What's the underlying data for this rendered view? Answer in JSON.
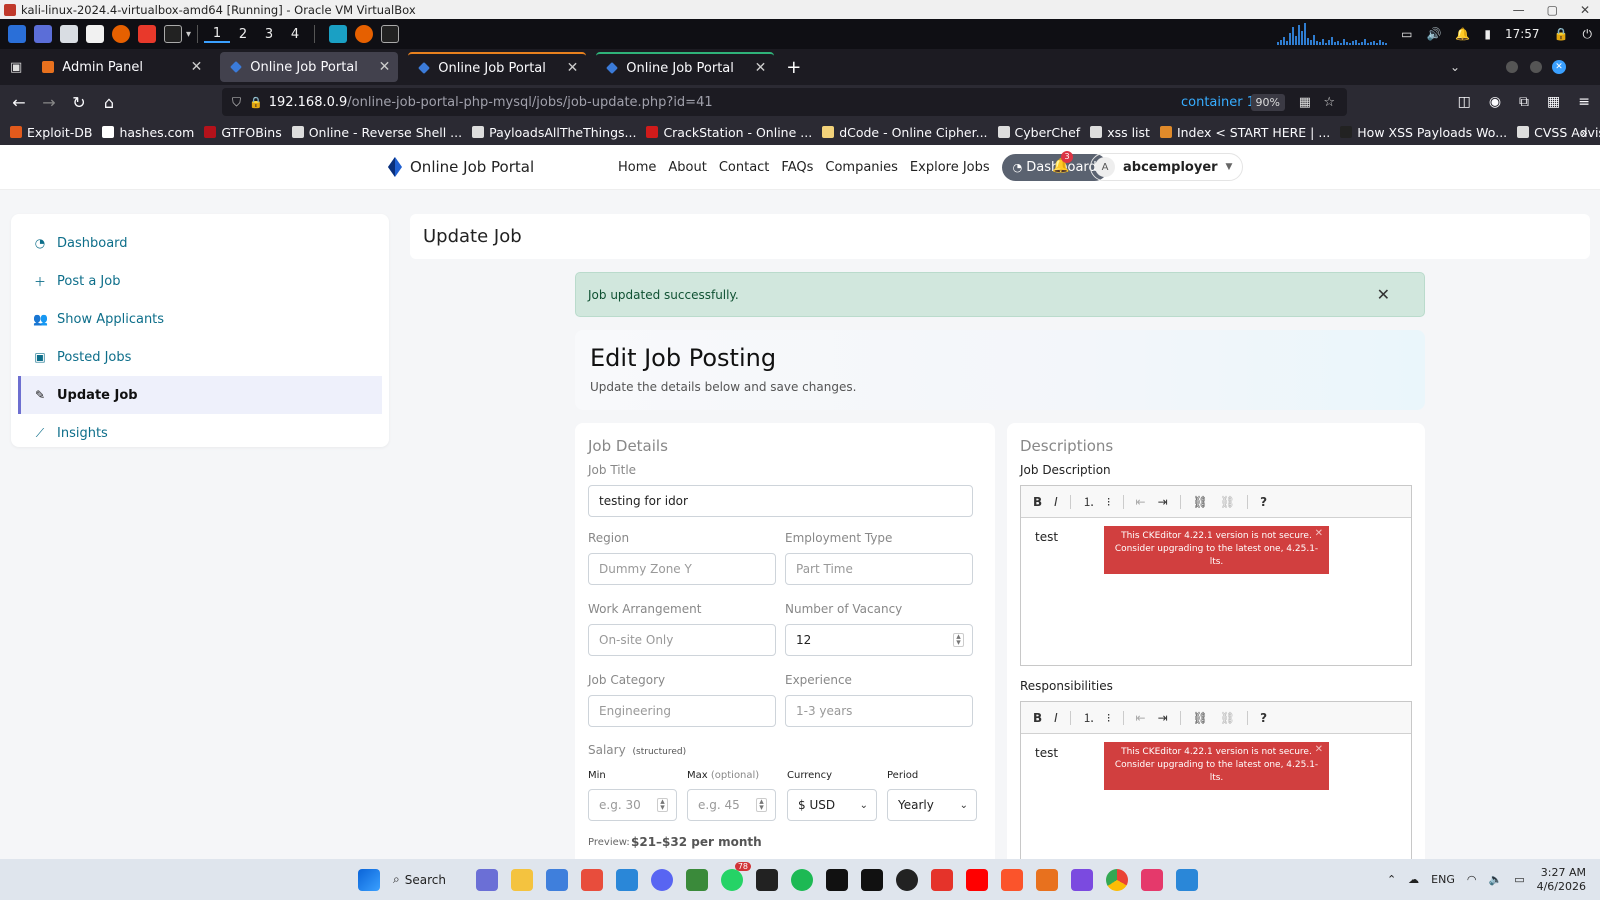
{
  "vbox": {
    "title": "kali-linux-2024.4-virtualbox-amd64 [Running] - Oracle VM VirtualBox",
    "controls": [
      "—",
      "▢",
      "✕"
    ]
  },
  "kali_panel": {
    "workspaces": [
      "1",
      "2",
      "3",
      "4"
    ],
    "time": "17:57"
  },
  "tabs": [
    {
      "label": "Admin Panel",
      "color": "#e8711e"
    },
    {
      "label": "Online Job Portal",
      "color": "#3b7bd9"
    },
    {
      "label": "Online Job Portal",
      "color": "#3b7bd9"
    },
    {
      "label": "Online Job Portal",
      "color": "#3b7bd9"
    }
  ],
  "urlbar": {
    "host": "192.168.0.9",
    "path": "/online-job-portal-php-mysql/jobs/job-update.php?id=41",
    "container": "container 1",
    "zoom": "90%"
  },
  "bookmarks": [
    {
      "label": "Exploit-DB",
      "color": "#e25a1c"
    },
    {
      "label": "hashes.com",
      "color": "#ffffff"
    },
    {
      "label": "GTFOBins",
      "color": "#b5121b"
    },
    {
      "label": "Online - Reverse Shell ...",
      "color": "#dddddd"
    },
    {
      "label": "PayloadsAllTheThings...",
      "color": "#dddddd"
    },
    {
      "label": "CrackStation - Online ...",
      "color": "#d11b1b"
    },
    {
      "label": "dCode - Online Cipher...",
      "color": "#f2d27a"
    },
    {
      "label": "CyberChef",
      "color": "#dddddd"
    },
    {
      "label": "xss list",
      "color": "#dddddd"
    },
    {
      "label": "Index < START HERE | ...",
      "color": "#e08a2a"
    },
    {
      "label": "How XSS Payloads Wo...",
      "color": "#222222"
    },
    {
      "label": "CVSS Advisor: A tool t...",
      "color": "#dddddd"
    }
  ],
  "site": {
    "brand": "Online Job Portal",
    "menu": [
      "Home",
      "About",
      "Contact",
      "FAQs",
      "Companies",
      "Explore Jobs"
    ],
    "dashboard_label": "Dashboard",
    "notif_count": "3",
    "user_initial": "A",
    "username": "abcemployer"
  },
  "sidebar": {
    "items": [
      {
        "label": "Dashboard",
        "icon": "dashboard-icon"
      },
      {
        "label": "Post a Job",
        "icon": "plus-icon"
      },
      {
        "label": "Show Applicants",
        "icon": "users-icon"
      },
      {
        "label": "Posted Jobs",
        "icon": "briefcase-icon"
      },
      {
        "label": "Update Job",
        "icon": "edit-icon"
      },
      {
        "label": "Insights",
        "icon": "chart-line-icon"
      }
    ],
    "active": "Update Job"
  },
  "header": {
    "title": "Update Job"
  },
  "alert": {
    "message": "Job updated successfully."
  },
  "hero": {
    "title": "Edit Job Posting",
    "subtitle": "Update the details below and save changes."
  },
  "job_details": {
    "section_title": "Job Details",
    "job_title_label": "Job Title",
    "job_title_value": "testing for idor",
    "region_label": "Region",
    "region_value": "Dummy Zone Y",
    "employment_label": "Employment Type",
    "employment_value": "Part Time",
    "work_label": "Work Arrangement",
    "work_value": "On-site Only",
    "vacancy_label": "Number of Vacancy",
    "vacancy_value": "12",
    "category_label": "Job Category",
    "category_value": "Engineering",
    "experience_label": "Experience",
    "experience_value": "1-3 years",
    "salary_label": "Salary",
    "salary_hint": "(structured)",
    "min_label": "Min",
    "min_placeholder": "e.g. 30",
    "max_label": "Max",
    "max_hint": "(optional)",
    "max_placeholder": "e.g. 45",
    "currency_label": "Currency",
    "currency_value": "$ USD",
    "period_label": "Period",
    "period_value": "Yearly",
    "preview_label": "Preview:",
    "preview_value": "$21–$32 per month"
  },
  "descriptions": {
    "section_title": "Descriptions",
    "job_desc_label": "Job Description",
    "job_desc_text": "test",
    "resp_label": "Responsibilities",
    "resp_text": "test",
    "ck_warning": "This CKEditor 4.22.1 version is not secure. Consider upgrading to the latest one, 4.25.1-lts."
  },
  "taskbar": {
    "search_label": "Search",
    "whatsapp_badge": "78",
    "lang": "ENG",
    "time": "3:27 AM",
    "date": "4/6/2026"
  }
}
